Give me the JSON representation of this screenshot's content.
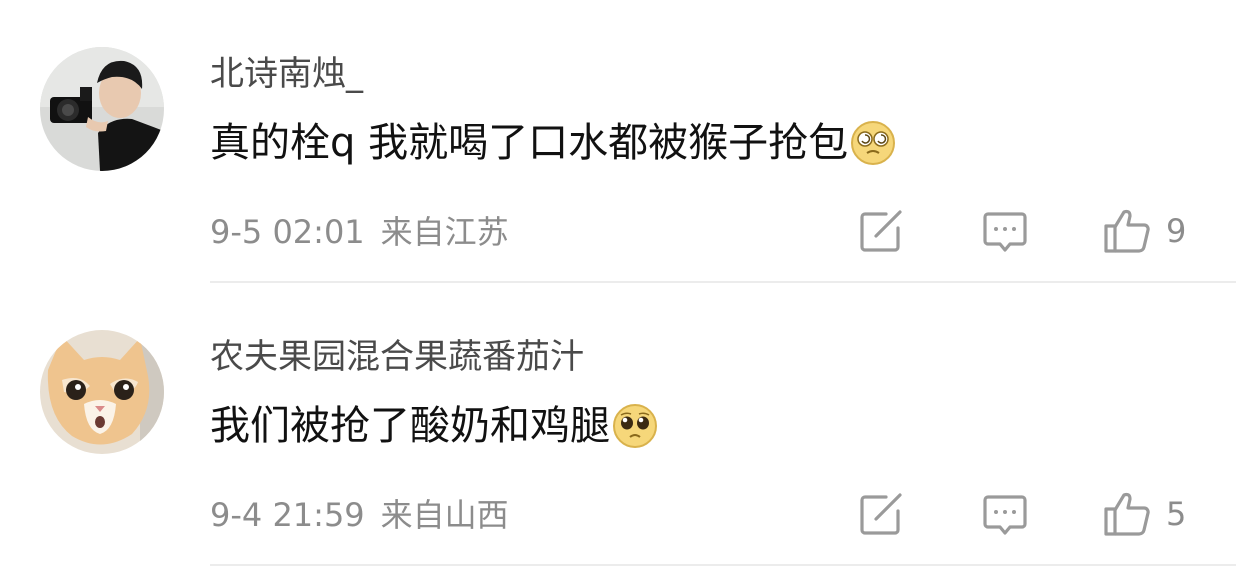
{
  "comments": [
    {
      "username": "北诗南烛_",
      "content": "真的栓q 我就喝了口水都被猴子抢包",
      "emoji": "dizzy-eyes-emoji",
      "time": "9-5 02:01",
      "location": "来自江苏",
      "likes": "9"
    },
    {
      "username": "农夫果园混合果蔬番茄汁",
      "content": "我们被抢了酸奶和鸡腿",
      "emoji": "pleading-face-emoji",
      "time": "9-4 21:59",
      "location": "来自山西",
      "likes": "5"
    }
  ],
  "icons": {
    "share": "share-edit-icon",
    "reply": "comment-bubble-icon",
    "like": "thumbs-up-icon"
  },
  "colors": {
    "username": "#4a4a4a",
    "content": "#111111",
    "meta": "#8c8c8c",
    "icon": "#9a9a9a",
    "divider": "#ececec"
  }
}
